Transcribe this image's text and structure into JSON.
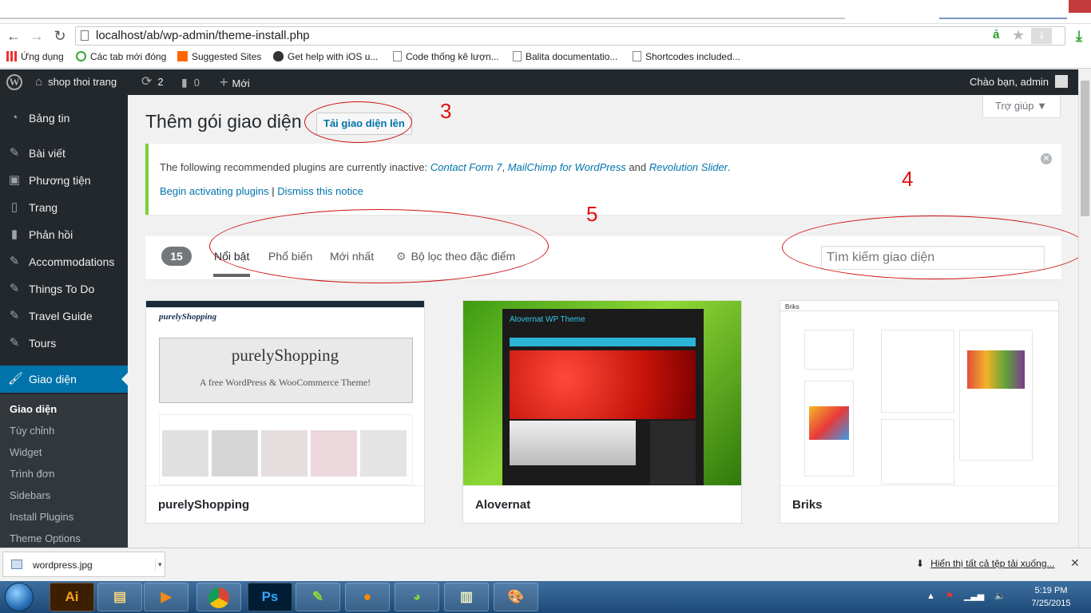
{
  "browser": {
    "url": "localhost/ab/wp-admin/theme-install.php",
    "bookmarks": [
      "Ứng dụng",
      "Các tab mới đóng",
      "Suggested Sites",
      "Get help with iOS u...",
      "Code thống kê lượn...",
      "Balita documentatio...",
      "Shortcodes included..."
    ]
  },
  "adminbar": {
    "site": "shop thoi trang",
    "updates": "2",
    "comments": "0",
    "new": "Mới",
    "greeting": "Chào bạn, admin"
  },
  "sidebar": {
    "items": [
      "Bảng tin",
      "Bài viết",
      "Phương tiện",
      "Trang",
      "Phản hồi",
      "Accommodations",
      "Things To Do",
      "Travel Guide",
      "Tours",
      "Giao diện"
    ],
    "submenu": [
      "Giao diện",
      "Tùy chỉnh",
      "Widget",
      "Trình đơn",
      "Sidebars",
      "Install Plugins",
      "Theme Options"
    ]
  },
  "main": {
    "help": "Trợ giúp ▼",
    "title": "Thêm gói giao diện",
    "upload": "Tải giao diện lên",
    "notice": {
      "prefix": "The following recommended plugins are currently inactive: ",
      "plugin1": "Contact Form 7",
      "sep": ", ",
      "plugin2": "MailChimp for WordPress",
      "and": " and ",
      "plugin3": "Revolution Slider",
      "end": ".",
      "activate": "Begin activating plugins",
      "pipe": " | ",
      "dismiss": "Dismiss this notice"
    },
    "filter": {
      "count": "15",
      "tabs": [
        "Nổi bật",
        "Phổ biến",
        "Mới nhất"
      ],
      "feature": "Bộ lọc theo đặc điểm",
      "search_placeholder": "Tìm kiếm giao diện"
    },
    "themes": [
      {
        "name": "purelyShopping",
        "tagline": "A free WordPress & WooCommerce Theme!"
      },
      {
        "name": "Alovernat",
        "tagline": "Alovernat WP Theme"
      },
      {
        "name": "Briks",
        "tagline": "Briks"
      }
    ]
  },
  "annotations": [
    "3",
    "4",
    "5"
  ],
  "download": {
    "file": "wordpress.jpg",
    "show_all": "Hiển thị tất cả tệp tải xuống..."
  },
  "taskbar": {
    "time": "5:19 PM",
    "date": "7/25/2015"
  },
  "colors": {
    "adminbar": "#23282d",
    "accent": "#0073aa",
    "notice": "#7ad03a",
    "annotation": "#e01010"
  }
}
